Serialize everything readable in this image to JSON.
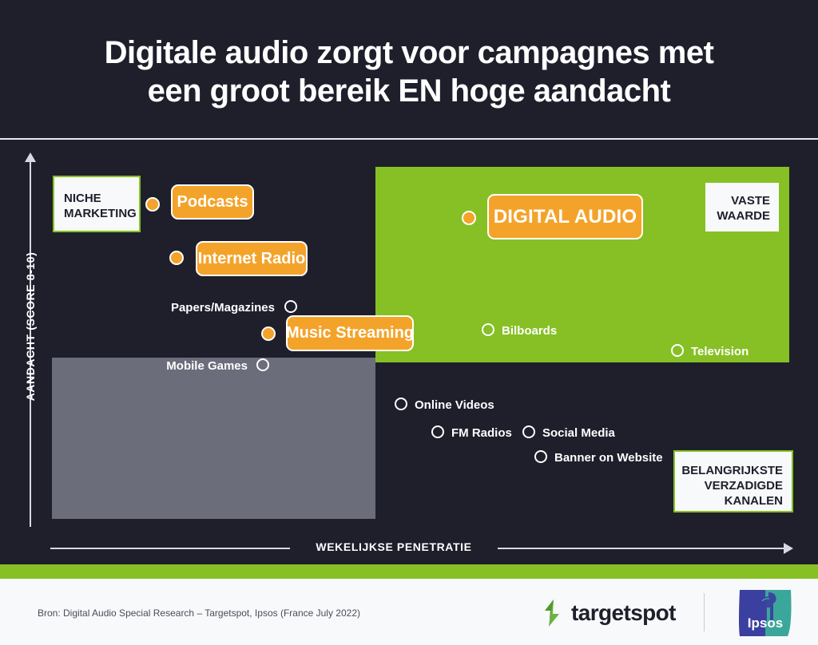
{
  "header": {
    "title": "Digitale audio zorgt voor campagnes met\neen groot bereik EN hoge aandacht"
  },
  "axes": {
    "y_label": "AANDACHT (SCORE 8-10)",
    "x_label": "WEKELIJKSE PENETRATIE"
  },
  "callouts": {
    "niche": "NICHE\nMARKETING",
    "vaste": "VASTE\nWAARDE",
    "belangrijkste": "BELANGRIJKSTE\nVERZADIGDE\nKANALEN"
  },
  "pills": {
    "podcasts": "Podcasts",
    "internet_radio": "Internet Radio",
    "music_streaming": "Music Streaming",
    "digital_audio": "DIGITAL AUDIO"
  },
  "plain_labels": {
    "papers": "Papers/Magazines",
    "mobile_games": "Mobile Games",
    "bilboards": "Bilboards",
    "television": "Television",
    "online_videos": "Online Videos",
    "fm_radios": "FM Radios",
    "social_media": "Social Media",
    "banner": "Banner on Website"
  },
  "footer": {
    "source": "Bron: Digital Audio Special Research – Targetspot, Ipsos (France July 2022)",
    "targetspot_wordmark": "targetspot",
    "ipsos_wordmark": "Ipsos"
  },
  "colors": {
    "background": "#1e1f2b",
    "green": "#86c025",
    "orange": "#f4a32a",
    "gray_zone": "#6b6d7a",
    "white": "#f8f9fb",
    "ipsos_blue": "#3b3fa0",
    "ipsos_teal": "#3aa79a"
  },
  "chart_data": {
    "type": "scatter",
    "title": "Digitale audio zorgt voor campagnes met een groot bereik EN hoge aandacht",
    "xlabel": "WEKELIJKSE PENETRATIE",
    "ylabel": "AANDACHT (SCORE 8-10)",
    "grid": false,
    "legend": null,
    "annotations": [
      {
        "text": "NICHE MARKETING",
        "region": "top-left",
        "style": "white-box-green-border"
      },
      {
        "text": "VASTE WAARDE",
        "region": "top-right",
        "style": "white-box-on-green"
      },
      {
        "text": "BELANGRIJKSTE VERZADIGDE KANALEN",
        "region": "bottom-right",
        "style": "white-box-green-border"
      }
    ],
    "regions": [
      {
        "name": "high-attention-high-penetration",
        "color": "#86c025",
        "x_range": [
          0.46,
          0.99
        ],
        "y_range": [
          0.48,
          0.95
        ]
      },
      {
        "name": "low-attention-low-penetration",
        "color": "#6b6d7a",
        "x_range": [
          0.04,
          0.45
        ],
        "y_range": [
          0.08,
          0.46
        ]
      }
    ],
    "points": [
      {
        "label": "Podcasts",
        "x": 0.18,
        "y": 0.87,
        "marker": "filled",
        "highlight": true,
        "color": "#f4a32a"
      },
      {
        "label": "Internet Radio",
        "x": 0.21,
        "y": 0.74,
        "marker": "filled",
        "highlight": true,
        "color": "#f4a32a"
      },
      {
        "label": "Papers/Magazines",
        "x": 0.34,
        "y": 0.57,
        "marker": "hollow",
        "highlight": false,
        "color": "#ffffff"
      },
      {
        "label": "Music Streaming",
        "x": 0.32,
        "y": 0.51,
        "marker": "filled",
        "highlight": true,
        "color": "#f4a32a"
      },
      {
        "label": "Mobile Games",
        "x": 0.3,
        "y": 0.44,
        "marker": "hollow",
        "highlight": false,
        "color": "#ffffff"
      },
      {
        "label": "DIGITAL AUDIO",
        "x": 0.56,
        "y": 0.85,
        "marker": "filled",
        "highlight": true,
        "color": "#f4a32a"
      },
      {
        "label": "Bilboards",
        "x": 0.59,
        "y": 0.52,
        "marker": "hollow",
        "highlight": false,
        "color": "#ffffff"
      },
      {
        "label": "Television",
        "x": 0.83,
        "y": 0.48,
        "marker": "hollow",
        "highlight": false,
        "color": "#ffffff"
      },
      {
        "label": "Online Videos",
        "x": 0.48,
        "y": 0.38,
        "marker": "hollow",
        "highlight": false,
        "color": "#ffffff"
      },
      {
        "label": "FM Radios",
        "x": 0.53,
        "y": 0.33,
        "marker": "hollow",
        "highlight": false,
        "color": "#ffffff"
      },
      {
        "label": "Social Media",
        "x": 0.64,
        "y": 0.33,
        "marker": "hollow",
        "highlight": false,
        "color": "#ffffff"
      },
      {
        "label": "Banner on Website",
        "x": 0.66,
        "y": 0.29,
        "marker": "hollow",
        "highlight": false,
        "color": "#ffffff"
      }
    ]
  }
}
